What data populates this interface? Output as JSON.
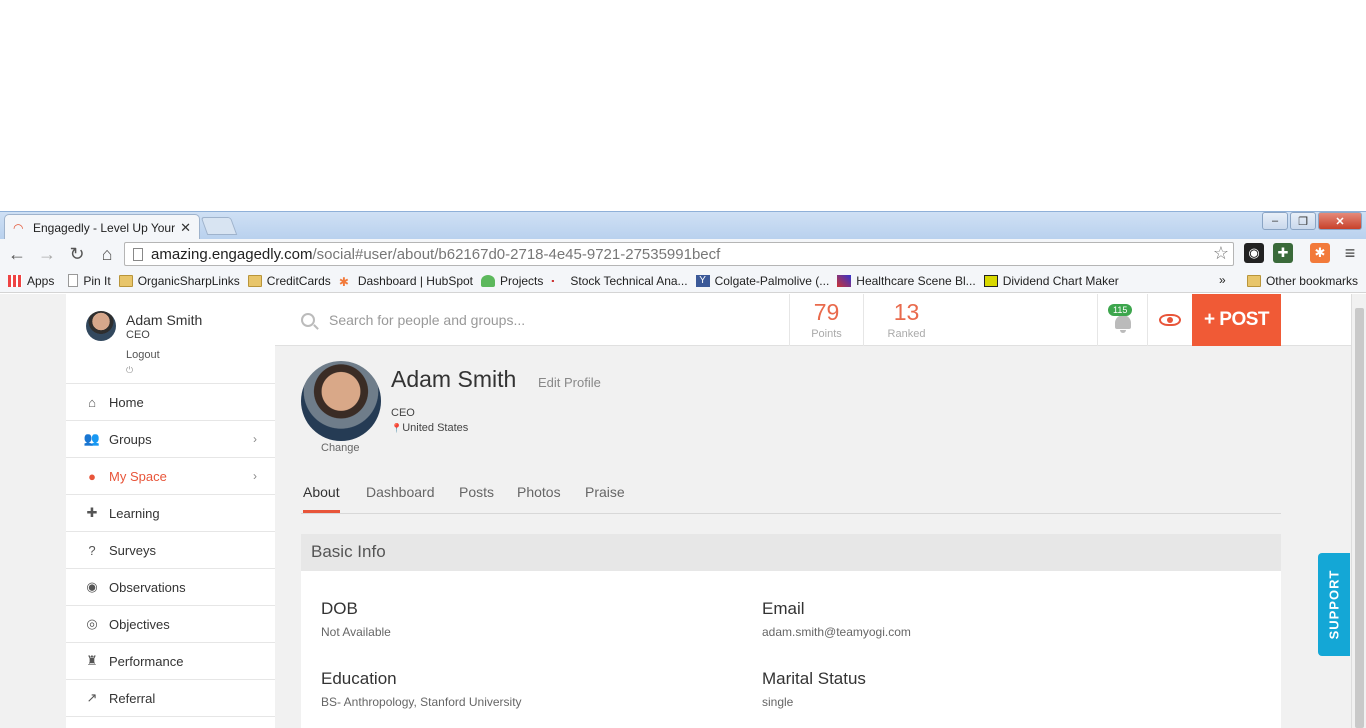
{
  "browser": {
    "tab_title": "Engagedly - Level Up Your",
    "tab_close": "✕",
    "url_host": "amazing.engagedly.com",
    "url_path": "/social#user/about/b62167d0-2718-4e45-9721-27535991becf"
  },
  "bookmarks": {
    "items": [
      "Apps",
      "Pin It",
      "OrganicSharpLinks",
      "CreditCards",
      "Dashboard | HubSpot",
      "Projects",
      "Stock Technical Ana...",
      "Colgate-Palmolive (...",
      "Healthcare Scene Bl...",
      "Dividend Chart Maker"
    ],
    "more": "»",
    "other": "Other bookmarks"
  },
  "topbar": {
    "search_placeholder": "Search for people and groups...",
    "points_value": "79",
    "points_label": "Points",
    "ranked_value": "13",
    "ranked_label": "Ranked",
    "notif_count": "115",
    "post_label": "+ POST"
  },
  "sidebar": {
    "user_name": "Adam Smith",
    "user_role": "CEO",
    "logout": "Logout",
    "nav": [
      {
        "label": "Home",
        "icon": "home-icon"
      },
      {
        "label": "Groups",
        "icon": "groups-icon"
      },
      {
        "label": "My Space",
        "icon": "user-icon"
      },
      {
        "label": "Learning",
        "icon": "puzzle-icon"
      },
      {
        "label": "Surveys",
        "icon": "question-icon"
      },
      {
        "label": "Observations",
        "icon": "eye-icon"
      },
      {
        "label": "Objectives",
        "icon": "target-icon"
      },
      {
        "label": "Performance",
        "icon": "trophy-icon"
      },
      {
        "label": "Referral",
        "icon": "external-link-icon"
      }
    ]
  },
  "profile": {
    "name": "Adam Smith",
    "edit": "Edit Profile",
    "role": "CEO",
    "location": "United States",
    "change": "Change",
    "tabs": [
      "About",
      "Dashboard",
      "Posts",
      "Photos",
      "Praise"
    ],
    "section_title": "Basic Info",
    "fields": {
      "dob_label": "DOB",
      "dob_value": "Not Available",
      "email_label": "Email",
      "email_value": "adam.smith@teamyogi.com",
      "education_label": "Education",
      "education_value": "BS- Anthropology, Stanford University",
      "marital_label": "Marital Status",
      "marital_value": "single"
    }
  },
  "support_label": "SUPPORT",
  "colors": {
    "accent": "#e8553a",
    "post": "#f05a36",
    "support": "#14a7d6",
    "badge": "#3da64d"
  }
}
